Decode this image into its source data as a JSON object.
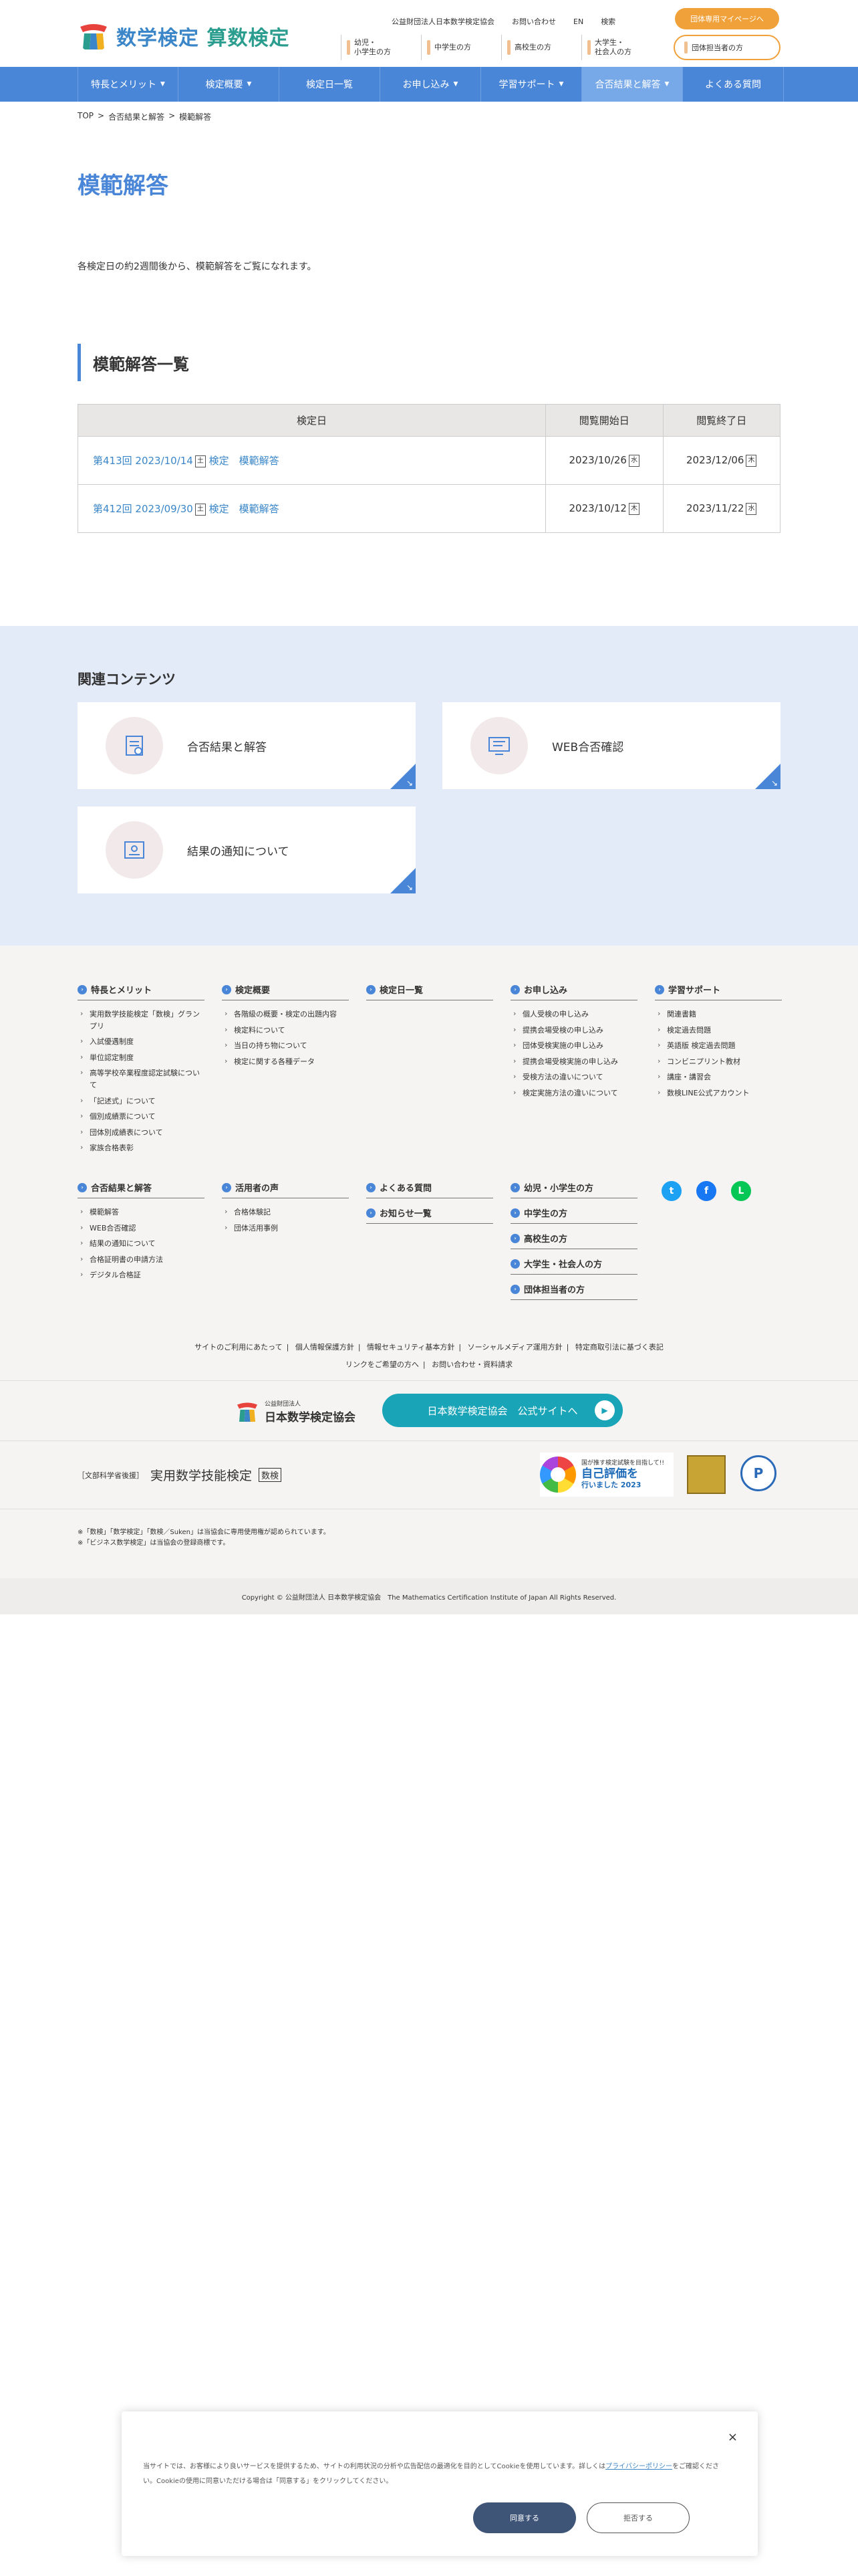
{
  "header": {
    "logo_text_a": "数学検定",
    "logo_text_b": "算数検定",
    "top_links": [
      "公益財団法人日本数学検定協会",
      "お問い合わせ",
      "EN",
      "検索"
    ],
    "mypage_button": "団体専用マイページへ",
    "audiences": [
      "幼児・\n小学生の方",
      "中学生の方",
      "高校生の方",
      "大学生・\n社会人の方"
    ],
    "group_button": "団体担当者の方"
  },
  "nav": {
    "items": [
      {
        "label": "特長とメリット",
        "caret": true
      },
      {
        "label": "検定概要",
        "caret": true
      },
      {
        "label": "検定日一覧",
        "caret": false
      },
      {
        "label": "お申し込み",
        "caret": true
      },
      {
        "label": "学習サポート",
        "caret": true
      },
      {
        "label": "合否結果と解答",
        "caret": true
      },
      {
        "label": "よくある質問",
        "caret": false
      }
    ]
  },
  "breadcrumb": [
    "TOP",
    ">",
    "合否結果と解答",
    ">",
    "模範解答"
  ],
  "page": {
    "title": "模範解答",
    "intro": "各検定日の約2週間後から、模範解答をご覧になれます。",
    "section_heading": "模範解答一覧"
  },
  "table": {
    "headers": [
      "検定日",
      "閲覧開始日",
      "閲覧終了日"
    ],
    "rows": [
      {
        "name_a": "第413回 2023/10/14",
        "name_b": "検定　模範解答",
        "start": "2023/10/26",
        "end": "2023/12/06",
        "mark_start": "水",
        "mark_end": "木",
        "mark_name": "土"
      },
      {
        "name_a": "第412回 2023/09/30",
        "name_b": "検定　模範解答",
        "start": "2023/10/12",
        "end": "2023/11/22",
        "mark_start": "木",
        "mark_end": "水",
        "mark_name": "土"
      }
    ]
  },
  "related": {
    "heading": "関連コンテンツ",
    "cards": [
      "合否結果と解答",
      "WEB合否確認",
      "結果の通知について"
    ]
  },
  "footer": {
    "columns": [
      {
        "head": "特長とメリット",
        "items": [
          "実用数学技能検定「数検」グランプリ",
          "入試優遇制度",
          "単位認定制度",
          "高等学校卒業程度認定試験について",
          "「記述式」について",
          "個別成績票について",
          "団体別成績表について",
          "家族合格表彰"
        ]
      },
      {
        "head": "検定概要",
        "items": [
          "各階級の概要・検定の出題内容",
          "検定料について",
          "当日の持ち物について",
          "検定に関する各種データ"
        ]
      },
      {
        "head": "検定日一覧",
        "items": []
      },
      {
        "head": "お申し込み",
        "items": [
          "個人受検の申し込み",
          "提携会場受検の申し込み",
          "団体受検実施の申し込み",
          "提携会場受検実施の申し込み",
          "受検方法の違いについて",
          "検定実施方法の違いについて"
        ]
      },
      {
        "head": "学習サポート",
        "items": [
          "関連書籍",
          "検定過去問題",
          "英語版 検定過去問題",
          "コンビニプリント教材",
          "講座・講習会",
          "数検LINE公式アカウント"
        ]
      },
      {
        "head": "合否結果と解答",
        "items": [
          "模範解答",
          "WEB合否確認",
          "結果の通知について",
          "合格証明書の申請方法",
          "デジタル合格証"
        ]
      },
      {
        "head": "活用者の声",
        "items": [
          "合格体験記",
          "団体活用事例"
        ]
      },
      {
        "head": "よくある質問",
        "items": []
      },
      {
        "head": "お知らせ一覧",
        "items": []
      },
      {
        "head": "幼児・小学生の方",
        "items": []
      },
      {
        "head": "中学生の方",
        "items": []
      },
      {
        "head": "高校生の方",
        "items": []
      },
      {
        "head": "大学生・社会人の方",
        "items": []
      },
      {
        "head": "団体担当者の方",
        "items": []
      }
    ],
    "social": [
      {
        "icon": "twitter-icon",
        "glyph": "t",
        "color": "#1da1f2"
      },
      {
        "icon": "facebook-icon",
        "glyph": "f",
        "color": "#1877f2"
      },
      {
        "icon": "line-icon",
        "glyph": "L",
        "color": "#06c755"
      }
    ],
    "links_row1": [
      "サイトのご利用にあたって",
      "個人情報保護方針",
      "情報セキュリティ基本方針",
      "ソーシャルメディア運用方針",
      "特定商取引法に基づく表記"
    ],
    "links_row2": [
      "リンクをご希望の方へ",
      "お問い合わせ・資料請求"
    ],
    "assoc_small": "公益財団法人",
    "assoc_name": "日本数学検定協会",
    "official_button": "日本数学検定協会　公式サイトへ",
    "mext_label": "［文部科学省後援］",
    "mext_name": "実用数学技能検定",
    "mext_box": "数検",
    "badge_small": "国が推す検定試験を目指して!!",
    "badge_big": "自己評価を",
    "badge_tail": "行いました 2023",
    "badge_mark": "P",
    "notes": [
      "※「数検」「数学検定」「数検／Suken」は当協会に専用使用権が認められています。",
      "※「ビジネス数学検定」は当協会の登録商標です。"
    ],
    "copyright": "Copyright © 公益財団法人 日本数学検定協会　The Mathematics Certification Institute of Japan All Rights Reserved."
  },
  "cookie": {
    "text_a": "当サイトでは、お客様により良いサービスを提供するため、サイトの利用状況の分析や広告配信の最適化を目的としてCookieを使用しています。詳しくは",
    "link": "プライバシーポリシー",
    "text_b": "をご確認ください。Cookieの使用に同意いただける場合は「同意する」をクリックしてください。",
    "accept": "同意する",
    "reject": "拒否する",
    "close": "×"
  },
  "colors": {
    "primary": "#4a86d8",
    "orange": "#f0a13a",
    "teal": "#1aa4b8",
    "related_bg": "#e3eaf8"
  }
}
